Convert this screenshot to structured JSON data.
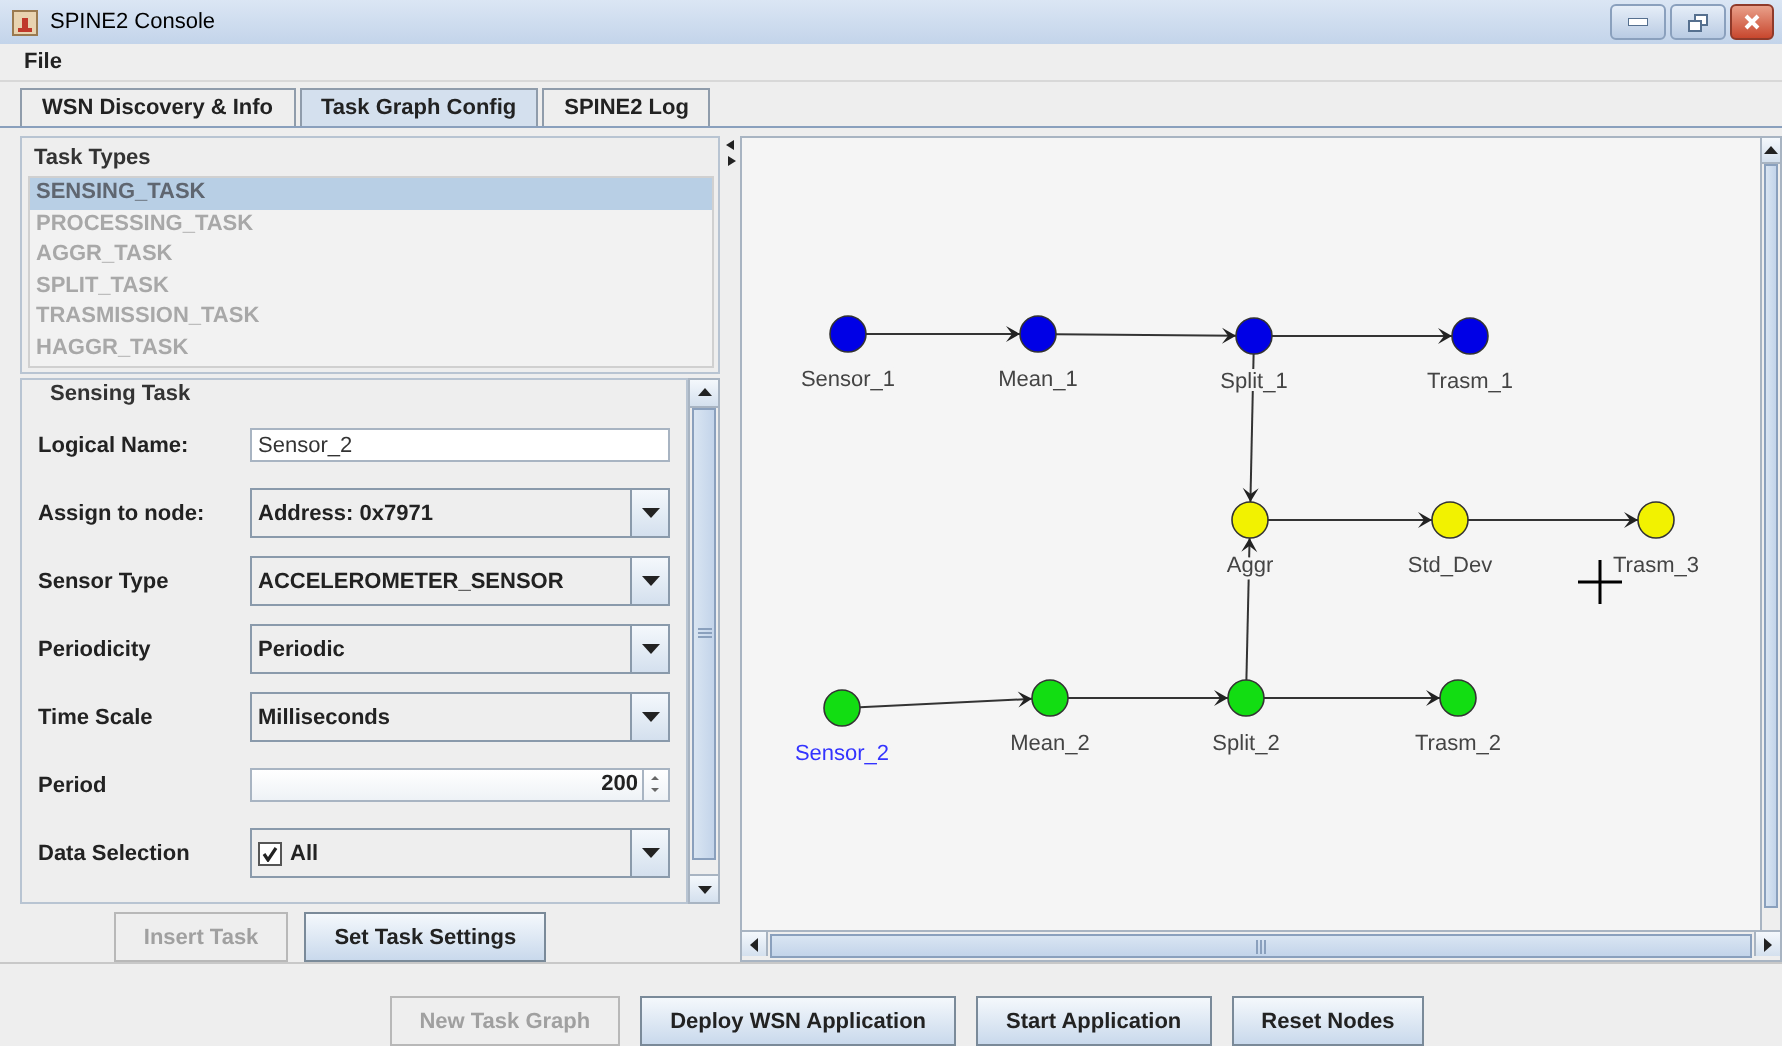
{
  "window": {
    "title": "SPINE2 Console"
  },
  "menu": [
    {
      "label": "File"
    }
  ],
  "tabs": [
    {
      "label": "WSN Discovery & Info",
      "selected": false
    },
    {
      "label": "Task Graph Config",
      "selected": true
    },
    {
      "label": "SPINE2 Log",
      "selected": false
    }
  ],
  "task_types": {
    "title": "Task Types",
    "items": [
      {
        "label": "SENSING_TASK",
        "selected": true
      },
      {
        "label": "PROCESSING_TASK",
        "selected": false
      },
      {
        "label": "AGGR_TASK",
        "selected": false
      },
      {
        "label": "SPLIT_TASK",
        "selected": false
      },
      {
        "label": "TRASMISSION_TASK",
        "selected": false
      },
      {
        "label": "HAGGR_TASK",
        "selected": false
      }
    ]
  },
  "task_form": {
    "title": "Sensing Task",
    "fields": [
      {
        "label": "Logical Name:",
        "kind": "text",
        "value": "Sensor_2"
      },
      {
        "label": "Assign to node:",
        "kind": "combo",
        "value": "Address: 0x7971"
      },
      {
        "label": "Sensor Type",
        "kind": "combo",
        "value": "ACCELEROMETER_SENSOR"
      },
      {
        "label": "Periodicity",
        "kind": "combo",
        "value": "Periodic"
      },
      {
        "label": "Time Scale",
        "kind": "combo",
        "value": "Milliseconds"
      },
      {
        "label": "Period",
        "kind": "spinner",
        "value": "200"
      },
      {
        "label": "Data Selection",
        "kind": "checkcombo",
        "value": "All",
        "checked": true
      }
    ]
  },
  "form_buttons": [
    {
      "label": "Insert Task",
      "disabled": true
    },
    {
      "label": "Set Task Settings",
      "disabled": false
    }
  ],
  "graph": {
    "nodes": [
      {
        "label": "Sensor_1",
        "color": "#0000e6",
        "selected": false
      },
      {
        "label": "Mean_1",
        "color": "#0000e6",
        "selected": false
      },
      {
        "label": "Split_1",
        "color": "#0000e6",
        "selected": false
      },
      {
        "label": "Trasm_1",
        "color": "#0000e6",
        "selected": false
      },
      {
        "label": "Aggr",
        "color": "#f2f200",
        "selected": false
      },
      {
        "label": "Std_Dev",
        "color": "#f2f200",
        "selected": false
      },
      {
        "label": "Trasm_3",
        "color": "#f2f200",
        "selected": false
      },
      {
        "label": "Sensor_2",
        "color": "#12dd12",
        "selected": true
      },
      {
        "label": "Mean_2",
        "color": "#12dd12",
        "selected": false
      },
      {
        "label": "Split_2",
        "color": "#12dd12",
        "selected": false
      },
      {
        "label": "Trasm_2",
        "color": "#12dd12",
        "selected": false
      }
    ]
  },
  "bottom_buttons": [
    {
      "label": "New Task Graph",
      "disabled": true
    },
    {
      "label": "Deploy WSN Application",
      "disabled": false
    },
    {
      "label": "Start Application",
      "disabled": false
    },
    {
      "label": "Reset Nodes",
      "disabled": false
    }
  ]
}
